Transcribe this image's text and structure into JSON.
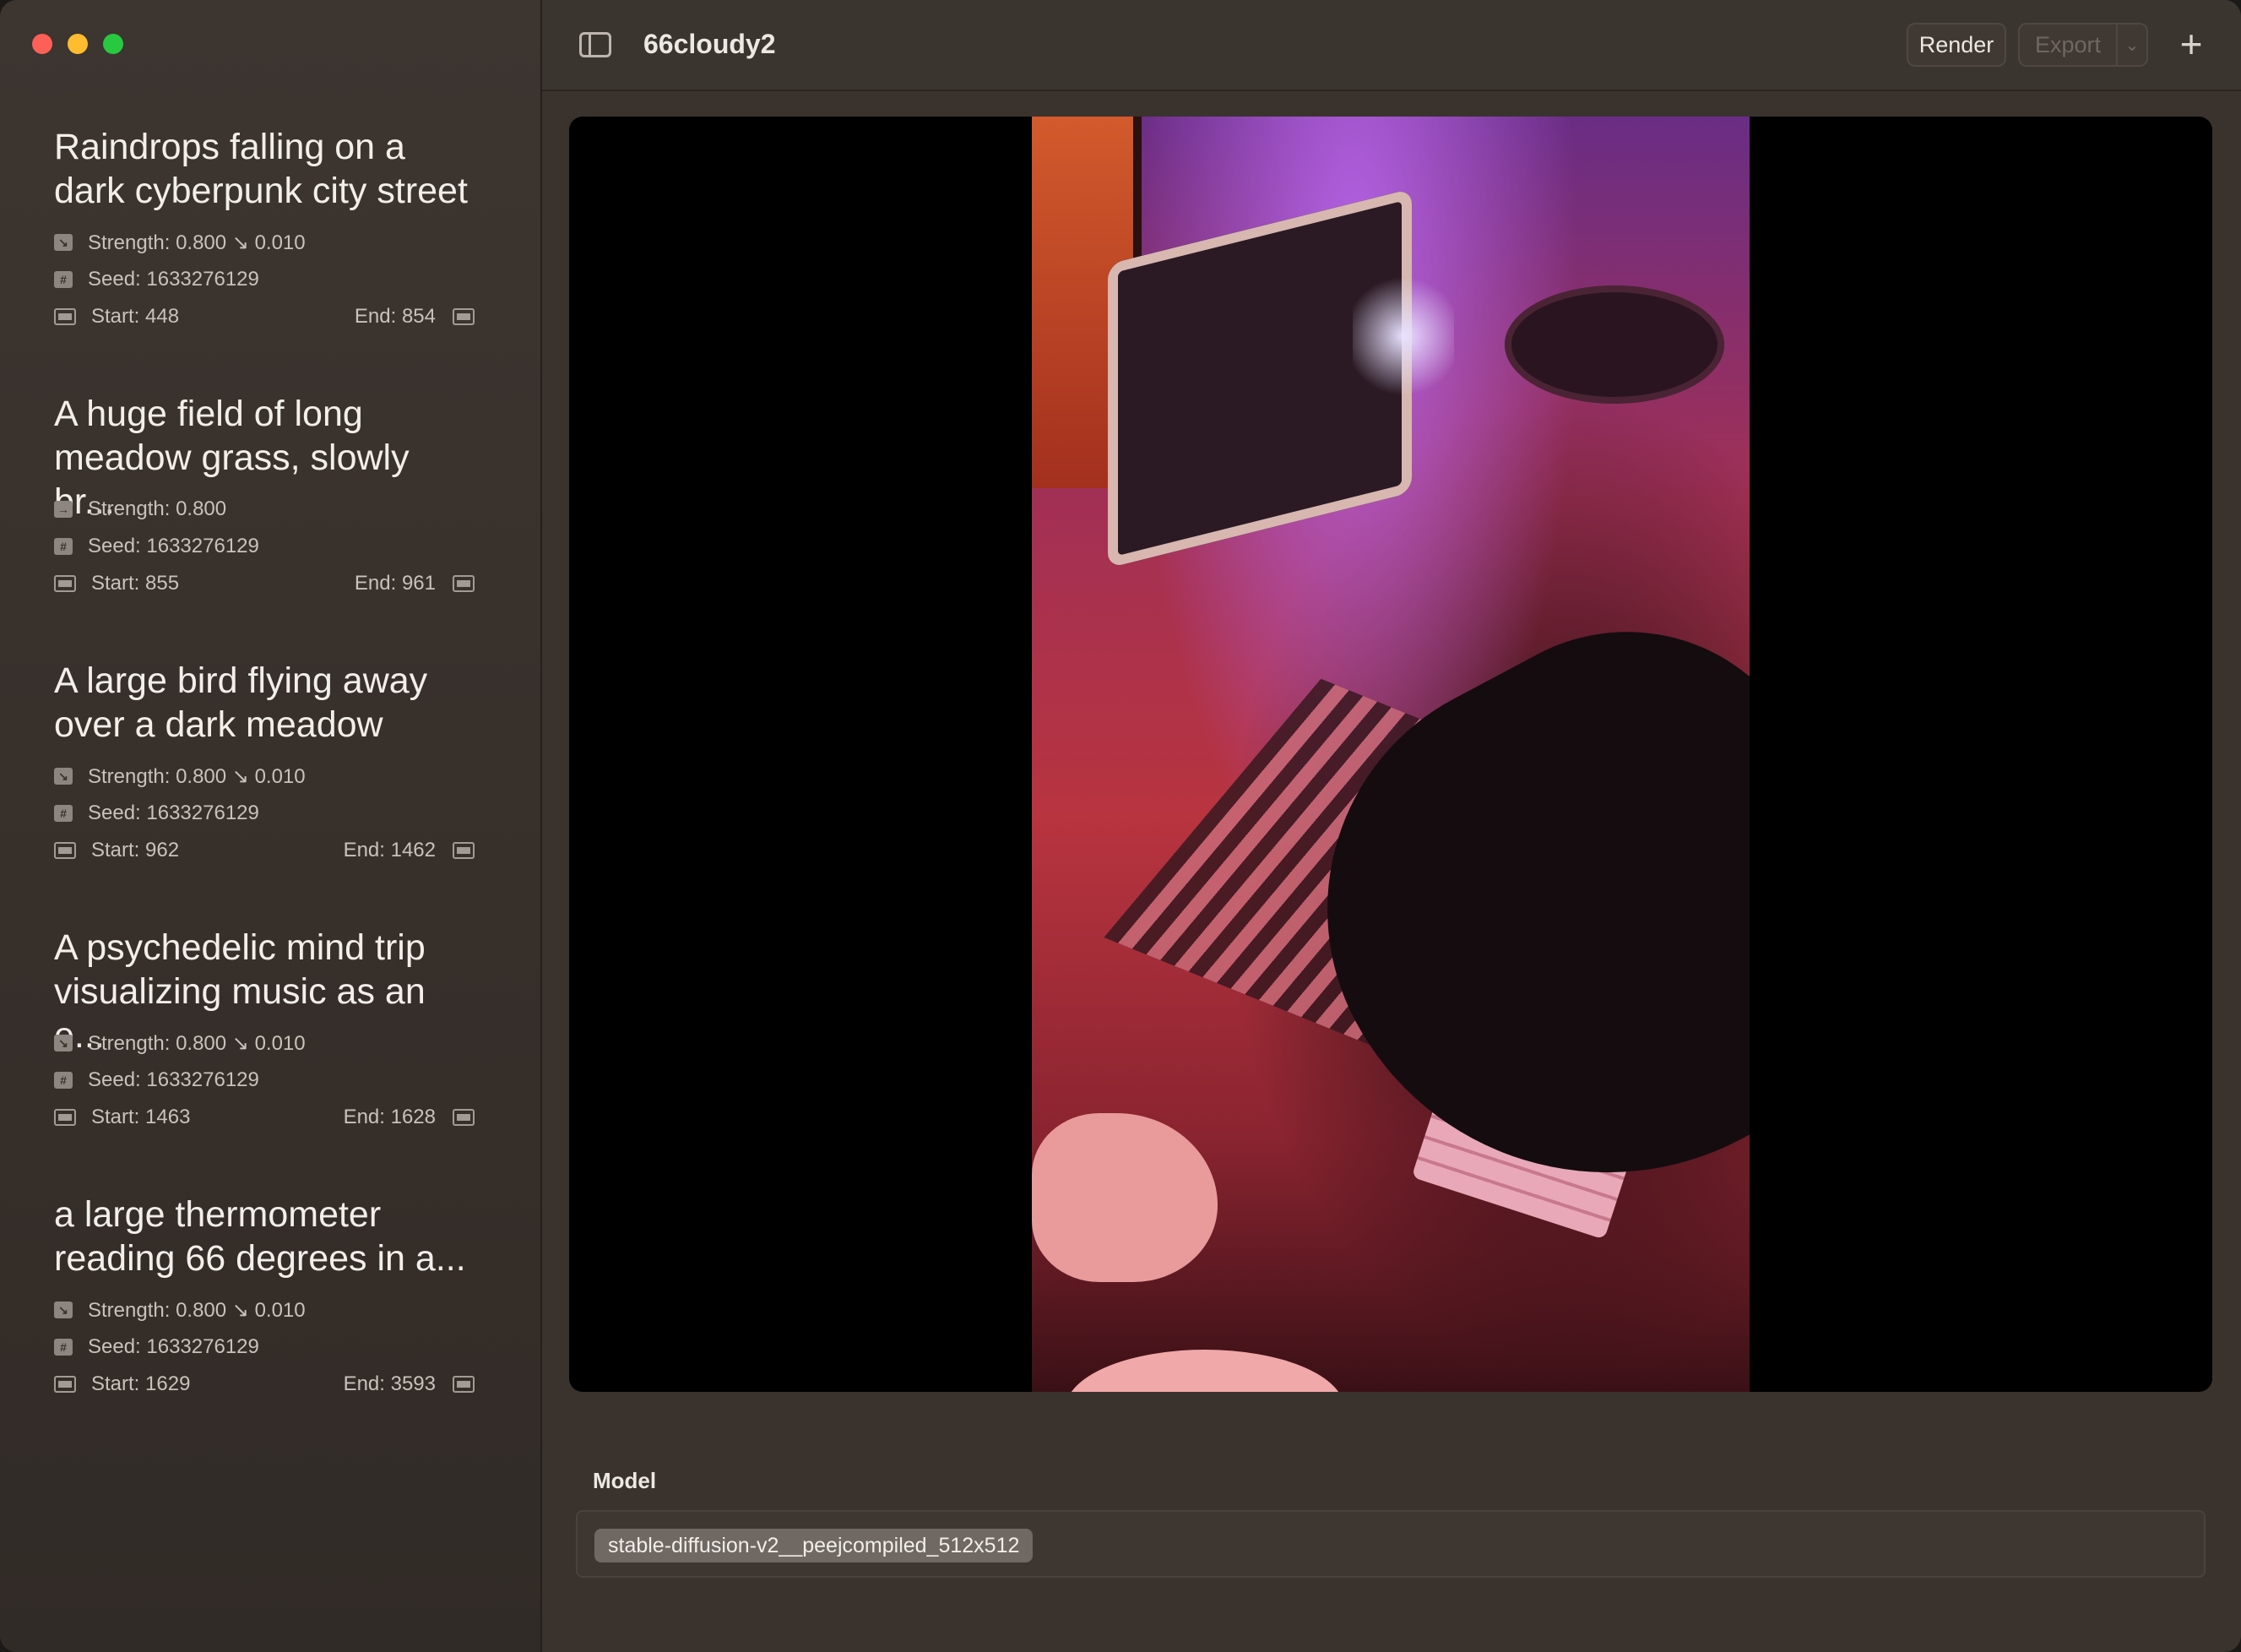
{
  "window": {
    "title": "66cloudy2"
  },
  "toolbar": {
    "render_label": "Render",
    "export_label": "Export",
    "export_menu_glyph": "⌄",
    "add_glyph": "+"
  },
  "prompts": [
    {
      "title": "Raindrops falling on a dark cyberpunk city street",
      "strength": "Strength: 0.800 ↘ 0.010",
      "seed": "Seed: 1633276129",
      "start": "Start: 448",
      "end": "End: 854"
    },
    {
      "title": "A huge field of long meadow grass, slowly br...",
      "strength": "Strength: 0.800",
      "seed": "Seed: 1633276129",
      "start": "Start: 855",
      "end": "End: 961"
    },
    {
      "title": "A large bird flying away over a dark  meadow",
      "strength": "Strength: 0.800 ↘ 0.010",
      "seed": "Seed: 1633276129",
      "start": "Start: 962",
      "end": "End: 1462"
    },
    {
      "title": "A psychedelic mind trip visualizing music as an e...",
      "strength": "Strength: 0.800 ↘ 0.010",
      "seed": "Seed: 1633276129",
      "start": "Start: 1463",
      "end": "End: 1628"
    },
    {
      "title": "a large thermometer reading 66 degrees in a...",
      "strength": "Strength: 0.800 ↘ 0.010",
      "seed": "Seed: 1633276129",
      "start": "Start: 1629",
      "end": "End: 3593"
    }
  ],
  "model": {
    "label": "Model",
    "value": "stable-diffusion-v2__peejcompiled_512x512"
  },
  "icons": {
    "strength": "strength-icon",
    "seed": "hash-icon",
    "frame": "film-frame-icon",
    "toggle": "sidebar-toggle-icon"
  },
  "colors": {
    "close": "#fe5f57",
    "minimize": "#febc2e",
    "zoom": "#28c840",
    "background": "#3a332d"
  }
}
